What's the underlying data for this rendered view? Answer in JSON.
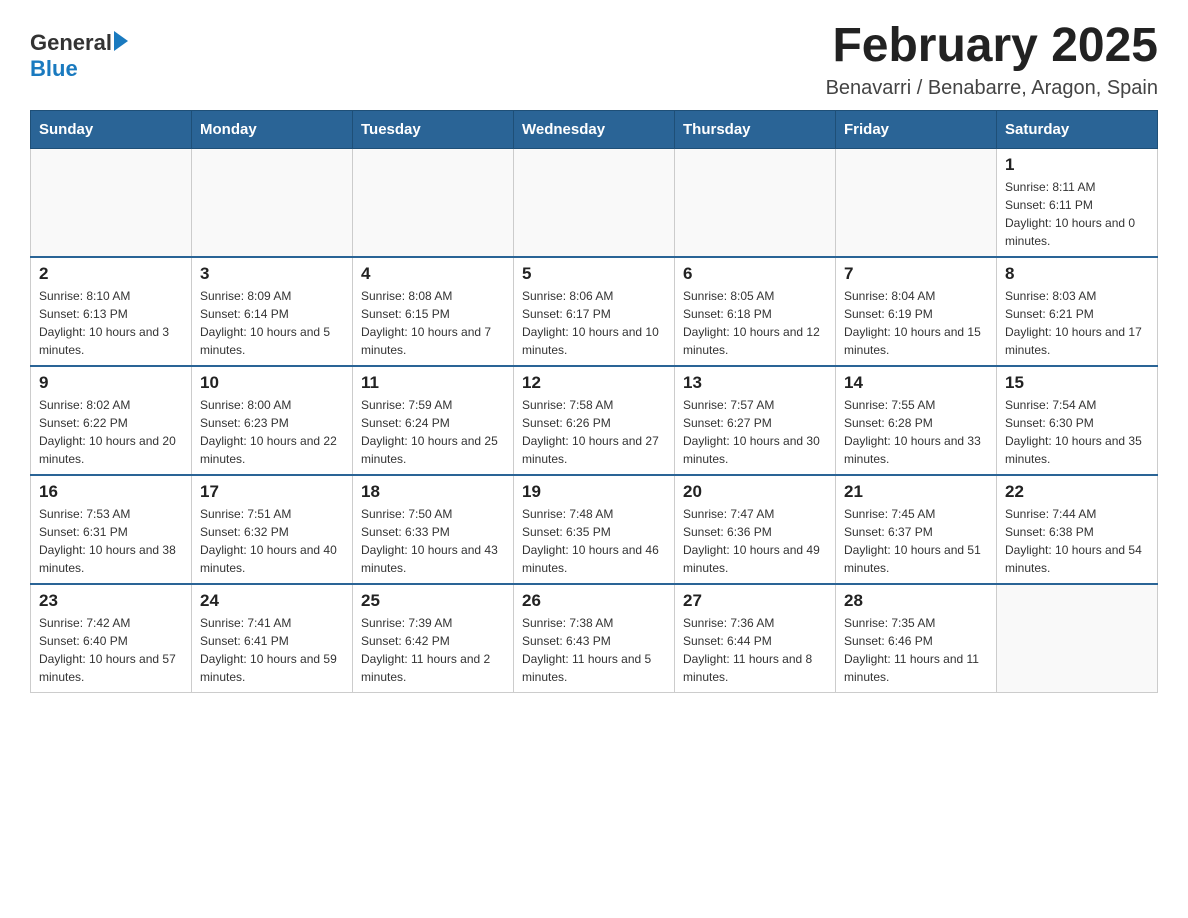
{
  "header": {
    "month_title": "February 2025",
    "location": "Benavarri / Benabarre, Aragon, Spain",
    "logo_general": "General",
    "logo_blue": "Blue"
  },
  "weekdays": [
    "Sunday",
    "Monday",
    "Tuesday",
    "Wednesday",
    "Thursday",
    "Friday",
    "Saturday"
  ],
  "weeks": [
    [
      {
        "day": "",
        "info": ""
      },
      {
        "day": "",
        "info": ""
      },
      {
        "day": "",
        "info": ""
      },
      {
        "day": "",
        "info": ""
      },
      {
        "day": "",
        "info": ""
      },
      {
        "day": "",
        "info": ""
      },
      {
        "day": "1",
        "info": "Sunrise: 8:11 AM\nSunset: 6:11 PM\nDaylight: 10 hours and 0 minutes."
      }
    ],
    [
      {
        "day": "2",
        "info": "Sunrise: 8:10 AM\nSunset: 6:13 PM\nDaylight: 10 hours and 3 minutes."
      },
      {
        "day": "3",
        "info": "Sunrise: 8:09 AM\nSunset: 6:14 PM\nDaylight: 10 hours and 5 minutes."
      },
      {
        "day": "4",
        "info": "Sunrise: 8:08 AM\nSunset: 6:15 PM\nDaylight: 10 hours and 7 minutes."
      },
      {
        "day": "5",
        "info": "Sunrise: 8:06 AM\nSunset: 6:17 PM\nDaylight: 10 hours and 10 minutes."
      },
      {
        "day": "6",
        "info": "Sunrise: 8:05 AM\nSunset: 6:18 PM\nDaylight: 10 hours and 12 minutes."
      },
      {
        "day": "7",
        "info": "Sunrise: 8:04 AM\nSunset: 6:19 PM\nDaylight: 10 hours and 15 minutes."
      },
      {
        "day": "8",
        "info": "Sunrise: 8:03 AM\nSunset: 6:21 PM\nDaylight: 10 hours and 17 minutes."
      }
    ],
    [
      {
        "day": "9",
        "info": "Sunrise: 8:02 AM\nSunset: 6:22 PM\nDaylight: 10 hours and 20 minutes."
      },
      {
        "day": "10",
        "info": "Sunrise: 8:00 AM\nSunset: 6:23 PM\nDaylight: 10 hours and 22 minutes."
      },
      {
        "day": "11",
        "info": "Sunrise: 7:59 AM\nSunset: 6:24 PM\nDaylight: 10 hours and 25 minutes."
      },
      {
        "day": "12",
        "info": "Sunrise: 7:58 AM\nSunset: 6:26 PM\nDaylight: 10 hours and 27 minutes."
      },
      {
        "day": "13",
        "info": "Sunrise: 7:57 AM\nSunset: 6:27 PM\nDaylight: 10 hours and 30 minutes."
      },
      {
        "day": "14",
        "info": "Sunrise: 7:55 AM\nSunset: 6:28 PM\nDaylight: 10 hours and 33 minutes."
      },
      {
        "day": "15",
        "info": "Sunrise: 7:54 AM\nSunset: 6:30 PM\nDaylight: 10 hours and 35 minutes."
      }
    ],
    [
      {
        "day": "16",
        "info": "Sunrise: 7:53 AM\nSunset: 6:31 PM\nDaylight: 10 hours and 38 minutes."
      },
      {
        "day": "17",
        "info": "Sunrise: 7:51 AM\nSunset: 6:32 PM\nDaylight: 10 hours and 40 minutes."
      },
      {
        "day": "18",
        "info": "Sunrise: 7:50 AM\nSunset: 6:33 PM\nDaylight: 10 hours and 43 minutes."
      },
      {
        "day": "19",
        "info": "Sunrise: 7:48 AM\nSunset: 6:35 PM\nDaylight: 10 hours and 46 minutes."
      },
      {
        "day": "20",
        "info": "Sunrise: 7:47 AM\nSunset: 6:36 PM\nDaylight: 10 hours and 49 minutes."
      },
      {
        "day": "21",
        "info": "Sunrise: 7:45 AM\nSunset: 6:37 PM\nDaylight: 10 hours and 51 minutes."
      },
      {
        "day": "22",
        "info": "Sunrise: 7:44 AM\nSunset: 6:38 PM\nDaylight: 10 hours and 54 minutes."
      }
    ],
    [
      {
        "day": "23",
        "info": "Sunrise: 7:42 AM\nSunset: 6:40 PM\nDaylight: 10 hours and 57 minutes."
      },
      {
        "day": "24",
        "info": "Sunrise: 7:41 AM\nSunset: 6:41 PM\nDaylight: 10 hours and 59 minutes."
      },
      {
        "day": "25",
        "info": "Sunrise: 7:39 AM\nSunset: 6:42 PM\nDaylight: 11 hours and 2 minutes."
      },
      {
        "day": "26",
        "info": "Sunrise: 7:38 AM\nSunset: 6:43 PM\nDaylight: 11 hours and 5 minutes."
      },
      {
        "day": "27",
        "info": "Sunrise: 7:36 AM\nSunset: 6:44 PM\nDaylight: 11 hours and 8 minutes."
      },
      {
        "day": "28",
        "info": "Sunrise: 7:35 AM\nSunset: 6:46 PM\nDaylight: 11 hours and 11 minutes."
      },
      {
        "day": "",
        "info": ""
      }
    ]
  ]
}
